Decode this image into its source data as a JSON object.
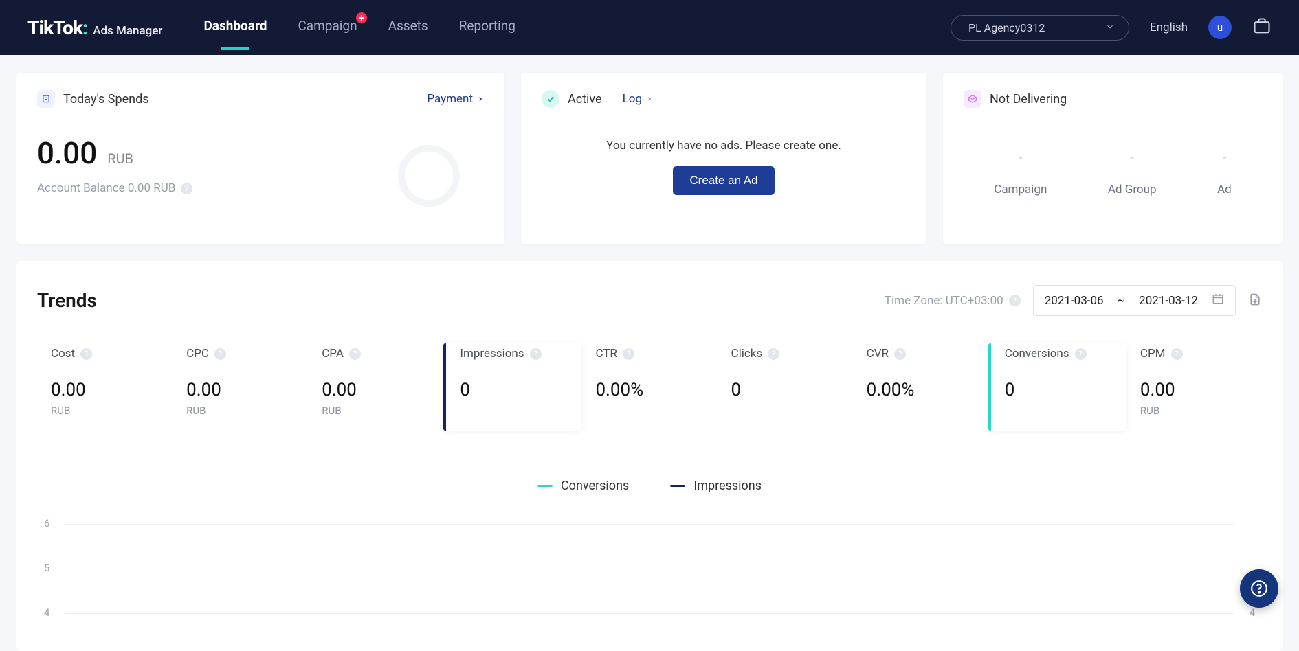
{
  "header": {
    "logo_main": "TikTok",
    "logo_sub": "Ads Manager",
    "nav": {
      "dashboard": "Dashboard",
      "campaign": "Campaign",
      "assets": "Assets",
      "reporting": "Reporting"
    },
    "account": "PL Agency0312",
    "language": "English",
    "avatar_initial": "u"
  },
  "spends": {
    "title": "Today's Spends",
    "payment_label": "Payment",
    "value": "0.00",
    "currency": "RUB",
    "balance_label": "Account Balance 0.00 RUB"
  },
  "active": {
    "title": "Active",
    "log_label": "Log",
    "empty_msg": "You currently have no ads. Please create one.",
    "cta": "Create an Ad"
  },
  "deliver": {
    "title": "Not Delivering",
    "cols": {
      "campaign": "Campaign",
      "adgroup": "Ad Group",
      "ad": "Ad"
    },
    "dash": "-"
  },
  "trends": {
    "title": "Trends",
    "tz": "Time Zone: UTC+03:00",
    "date_from": "2021-03-06",
    "date_sep": "~",
    "date_to": "2021-03-12",
    "legend": {
      "conversions": "Conversions",
      "impressions": "Impressions"
    },
    "metrics": [
      {
        "label": "Cost",
        "value": "0.00",
        "unit": "RUB"
      },
      {
        "label": "CPC",
        "value": "0.00",
        "unit": "RUB"
      },
      {
        "label": "CPA",
        "value": "0.00",
        "unit": "RUB"
      },
      {
        "label": "Impressions",
        "value": "0",
        "unit": ""
      },
      {
        "label": "CTR",
        "value": "0.00%",
        "unit": ""
      },
      {
        "label": "Clicks",
        "value": "0",
        "unit": ""
      },
      {
        "label": "CVR",
        "value": "0.00%",
        "unit": ""
      },
      {
        "label": "Conversions",
        "value": "0",
        "unit": ""
      },
      {
        "label": "CPM",
        "value": "0.00",
        "unit": "RUB"
      }
    ],
    "yticks": [
      "6",
      "5",
      "4"
    ],
    "ytick_right": "4"
  },
  "chart_data": {
    "type": "line",
    "title": "Trends",
    "x_range": [
      "2021-03-06",
      "2021-03-12"
    ],
    "series": [
      {
        "name": "Conversions",
        "color": "#27d7cb",
        "values": []
      },
      {
        "name": "Impressions",
        "color": "#12256a",
        "values": []
      }
    ],
    "y_left_visible_ticks": [
      6,
      5,
      4
    ],
    "y_right_visible_ticks": [
      4
    ]
  }
}
